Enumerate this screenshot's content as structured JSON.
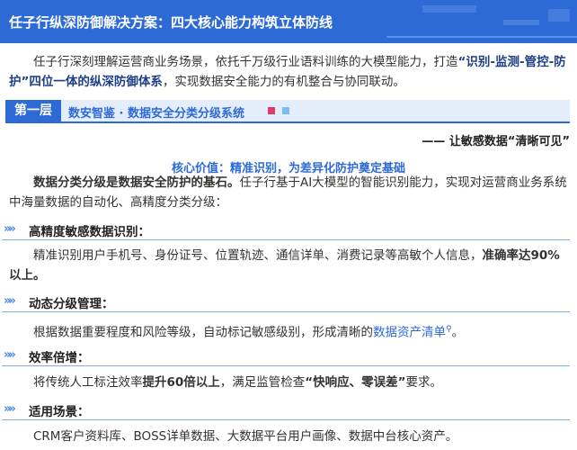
{
  "title": "任子行纵深防御解决方案：四大核心能力构筑立体防线",
  "intro": {
    "text_1": "任子行深刻理解运营商业务场景，依托千万级行业语料训练的大模型能力，打造",
    "bold_1": "“识别-监测-管控-防护”四位一体的纵深防御体系",
    "text_2": "，实现数据安全能力的有机整合与协同联动。"
  },
  "layer": {
    "tag": "第一层",
    "name": "数安智鉴 · 数据安全分类分级系统",
    "accent_colors": [
      "#e03c6b",
      "#7cbdf0"
    ]
  },
  "tagline": "—— 让敏感数据“清晰可见”",
  "core_value": "核心价值：精准识别，为差异化防护奠定基础",
  "para": {
    "bold": "数据分类分级是数据安全防护的基石。",
    "text": "任子行基于AI大模型的智能识别能力，实现对运营商业务系统中海量数据的自动化、高精度分类分级："
  },
  "sections": [
    {
      "title": "高精度敏感数据识别：",
      "text": "精准识别用户手机号、身份证号、位置轨迹、通信详单、消费记录等高敏个人信息，",
      "bold": "准确率达90%以上。"
    },
    {
      "title": "动态分级管理：",
      "text": "根据数据重要程度和风险等级，自动标记敏感级别，形成清晰的",
      "link": "数据资产清单",
      "tail": "。"
    },
    {
      "title": "效率倍增：",
      "text": "将传统人工标注效率",
      "bold": "提升60倍以上",
      "text_2": "，满足监管检查",
      "bold_2": "“快响应、零误差”",
      "text_3": "要求。"
    },
    {
      "title": "适用场景：",
      "text": "CRM客户资料库、BOSS详单数据、大数据平台用户画像、数据中台核心资产。"
    }
  ],
  "section_icon": "double-chevron-icon",
  "brand_color": "#2e6ad6"
}
